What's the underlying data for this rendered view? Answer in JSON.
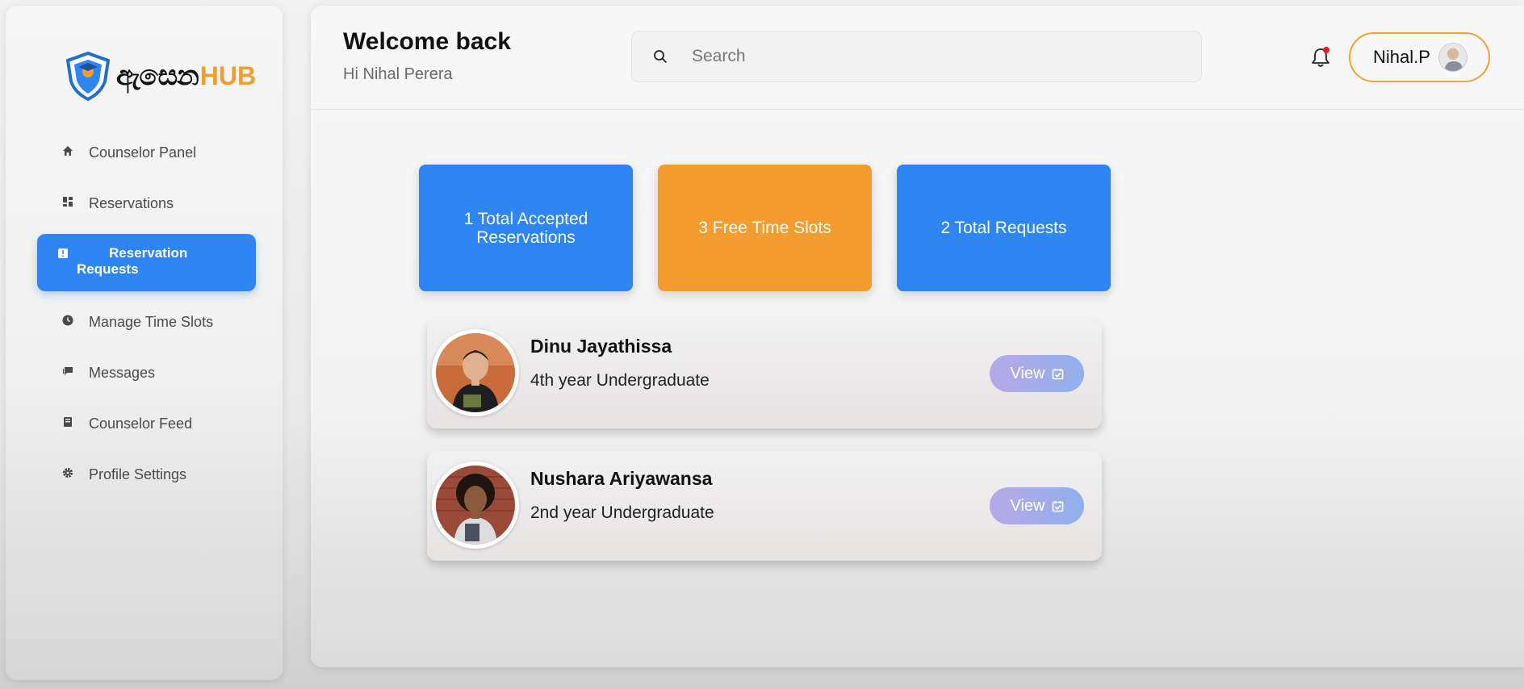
{
  "sidebar": {
    "logo": {
      "script_text": "ඇසෙන",
      "hub_text": "HUB"
    },
    "items": [
      {
        "label": "Counselor Panel",
        "icon": "home-icon",
        "active": false
      },
      {
        "label": "Reservations",
        "icon": "dashboard-icon",
        "active": false
      },
      {
        "label": "Reservation Requests",
        "icon": "alert-badge-icon",
        "active": true
      },
      {
        "label": "Manage Time Slots",
        "icon": "clock-icon",
        "active": false
      },
      {
        "label": "Messages",
        "icon": "chat-icon",
        "active": false
      },
      {
        "label": "Counselor Feed",
        "icon": "book-icon",
        "active": false
      },
      {
        "label": "Profile Settings",
        "icon": "gear-icon",
        "active": false
      }
    ]
  },
  "header": {
    "title": "Welcome back",
    "greeting": "Hi Nihal Perera",
    "search": {
      "placeholder": "Search",
      "value": ""
    },
    "user": {
      "name": "Nihal.P"
    }
  },
  "stats": [
    {
      "label": "1 Total Accepted Reservations",
      "color": "#2e86f5"
    },
    {
      "label": "3 Free Time Slots",
      "color": "#f39c2f"
    },
    {
      "label": "2 Total Requests",
      "color": "#2e86f5"
    }
  ],
  "requests": [
    {
      "name": "Dinu Jayathissa",
      "year": "4th year Undergraduate",
      "button": "View"
    },
    {
      "name": "Nushara Ariyawansa",
      "year": "2nd year Undergraduate",
      "button": "View"
    }
  ],
  "colors": {
    "accent_blue": "#2e86f5",
    "accent_orange": "#f39c2f",
    "notification_dot": "#e02020"
  }
}
